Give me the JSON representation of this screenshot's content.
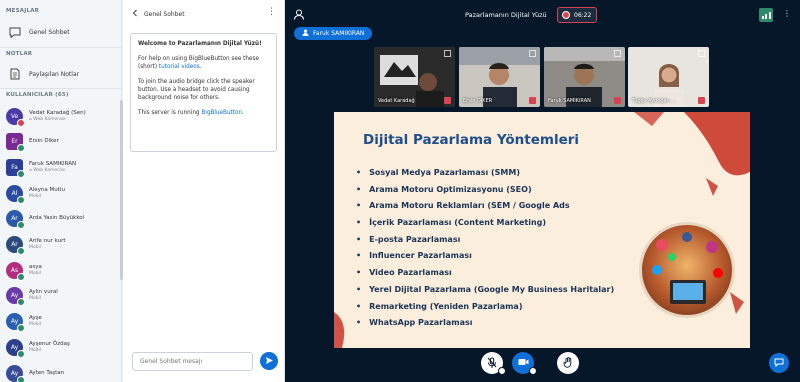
{
  "sidebar": {
    "messages_header": "MESAJLAR",
    "public_chat_label": "Genel Sohbet",
    "notes_header": "NOTLAR",
    "shared_notes_label": "Paylaşılan Notlar",
    "users_header": "KULLANICILAR (65)",
    "users": [
      {
        "initials": "Ve",
        "name": "Vedat Karadağ (Sen)",
        "sub": "⌂ Web Kamerası",
        "color": "#4a3ba8",
        "shape": "round"
      },
      {
        "initials": "Er",
        "name": "Ersin Diker",
        "sub": "",
        "color": "#7b2a95",
        "shape": "square"
      },
      {
        "initials": "Fa",
        "name": "Faruk SAMIKIRAN",
        "sub": "⌂ Web Kamerası",
        "color": "#2c3e95",
        "shape": "square"
      },
      {
        "initials": "Al",
        "name": "Aleyna Mutlu",
        "sub": "Mobil",
        "color": "#2b4aa0",
        "shape": "round"
      },
      {
        "initials": "Ar",
        "name": "Arda Yasin Büyükkol",
        "sub": "",
        "color": "#2c5aa8",
        "shape": "round"
      },
      {
        "initials": "Ar",
        "name": "Arife nur kurt",
        "sub": "Mobil",
        "color": "#2c4b7a",
        "shape": "round"
      },
      {
        "initials": "As",
        "name": "asya",
        "sub": "Mobil",
        "color": "#b32e7e",
        "shape": "round"
      },
      {
        "initials": "Ay",
        "name": "Aylin vural",
        "sub": "Mobil",
        "color": "#6a3aa8",
        "shape": "round"
      },
      {
        "initials": "Ay",
        "name": "Ayşe",
        "sub": "Mobil",
        "color": "#2b5fb0",
        "shape": "round"
      },
      {
        "initials": "Ay",
        "name": "Ayşenur Özdaş",
        "sub": "Mobil",
        "color": "#2b3f8a",
        "shape": "round"
      },
      {
        "initials": "Ay",
        "name": "Ayten Taştan",
        "sub": "",
        "color": "#3a4a9a",
        "shape": "round"
      }
    ]
  },
  "chat": {
    "title": "Genel Sohbet",
    "welcome_title": "Pazarlamanın Dijital Yüzü!",
    "welcome_prefix": "Welcome to ",
    "help_pre": "For help on using BigBlueButton see these (short) ",
    "help_link": "tutorial videos",
    "help_post": ".",
    "audio_text": "To join the audio bridge click the speaker button. Use a headset to avoid causing background noise for others.",
    "server_pre": "This server is running ",
    "server_link": "BigBlueButton",
    "server_post": ".",
    "input_placeholder": "Genel Sohbet mesajı"
  },
  "meeting": {
    "title": "Pazarlamanın Dijital Yüzü",
    "recording_time": "06:22",
    "presenter_name": "Faruk SAMIKIRAN",
    "accent": "#0f70d7",
    "record_color": "#d9434f",
    "cameras": [
      {
        "name": "Vedat Karadağ"
      },
      {
        "name": "Ersin DİKER"
      },
      {
        "name": "Faruk SAMIKIRAN"
      },
      {
        "name": "Tuğçe Aydoğan ..."
      }
    ]
  },
  "slide": {
    "title": "Dijital Pazarlama Yöntemleri",
    "bullets": [
      "Sosyal Medya Pazarlaması (SMM)",
      "Arama Motoru Optimizasyonu (SEO)",
      "Arama Motoru Reklamları (SEM / Google Ads",
      "İçerik Pazarlaması (Content Marketing)",
      "E-posta Pazarlaması",
      "Influencer Pazarlaması",
      "Video Pazarlaması",
      "Yerel Dijital Pazarlama (Google My Business  Haritalar)",
      "Remarketing (Yeniden Pazarlama)",
      "WhatsApp Pazarlaması"
    ]
  }
}
